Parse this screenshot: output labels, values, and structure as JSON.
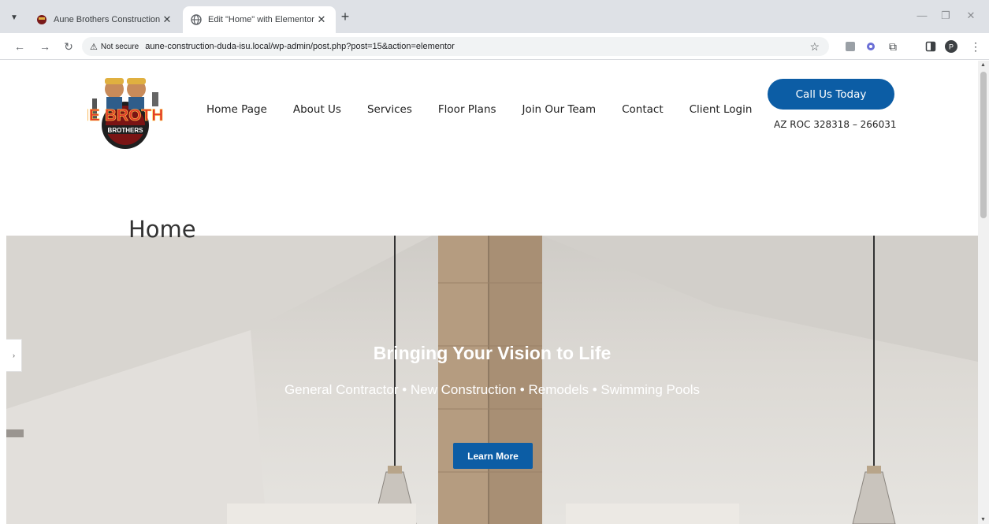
{
  "browser": {
    "tabs": [
      {
        "title": "Aune Brothers Construction",
        "active": false
      },
      {
        "title": "Edit \"Home\" with Elementor",
        "active": true
      }
    ],
    "security_label": "Not secure",
    "url": "aune-construction-duda-isu.local/wp-admin/post.php?post=15&action=elementor",
    "profile_initial": "P"
  },
  "site": {
    "logo_alt": "AUNE BROTHERS",
    "nav": [
      "Home Page",
      "About Us",
      "Services",
      "Floor Plans",
      "Join Our Team",
      "Contact",
      "Client Login"
    ],
    "cta_label": "Call Us Today",
    "license": "AZ ROC 328318 – 266031",
    "page_title": "Home"
  },
  "hero": {
    "heading": "Bringing Your Vision to Life",
    "subheading": "General Contractor • New Construction • Remodels • Swimming Pools",
    "button_label": "Learn More"
  },
  "colors": {
    "brand_blue": "#0c5da5",
    "tabbar": "#dee1e6"
  }
}
